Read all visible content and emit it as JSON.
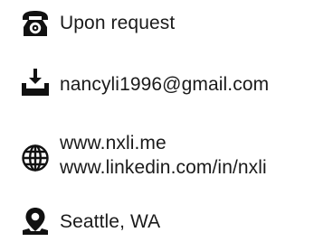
{
  "contact": {
    "phone": "Upon request",
    "email": "nancyli1996@gmail.com",
    "website": "www.nxli.me",
    "linkedin": "www.linkedin.com/in/nxli",
    "location": "Seattle, WA"
  },
  "icons": {
    "phone": "telephone-icon",
    "email": "inbox-download-icon",
    "web": "globe-icon",
    "location": "map-pin-icon"
  },
  "colors": {
    "icon": "#111111",
    "text": "#1a1a1a"
  }
}
